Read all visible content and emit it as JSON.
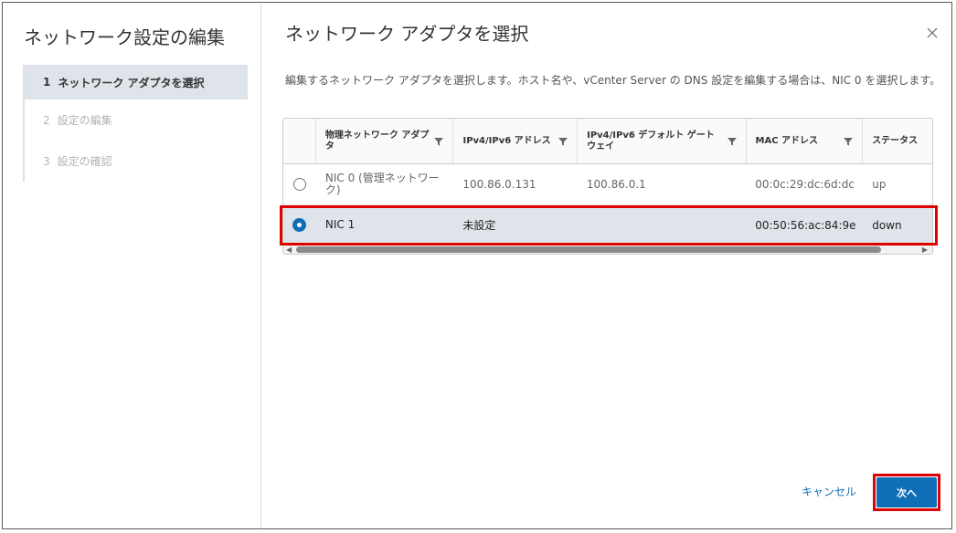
{
  "wizard": {
    "title": "ネットワーク設定の編集",
    "steps": [
      {
        "num": "1",
        "label": "ネットワーク アダプタを選択"
      },
      {
        "num": "2",
        "label": "設定の編集"
      },
      {
        "num": "3",
        "label": "設定の確認"
      }
    ]
  },
  "page": {
    "title": "ネットワーク アダプタを選択",
    "description": "編集するネットワーク アダプタを選択します。ホスト名や、vCenter Server の DNS 設定を編集する場合は、NIC 0 を選択します。",
    "close_icon": "close-icon"
  },
  "grid": {
    "columns": [
      "物理ネットワーク アダプタ",
      "IPv4/IPv6 アドレス",
      "IPv4/IPv6 デフォルト ゲートウェイ",
      "MAC アドレス",
      "ステータス"
    ],
    "rows": [
      {
        "name": "NIC 0 (管理ネットワーク)",
        "ip": "100.86.0.131",
        "gateway": "100.86.0.1",
        "mac": "00:0c:29:dc:6d:dc",
        "status": "up",
        "selected": false
      },
      {
        "name": "NIC 1",
        "ip": "未設定",
        "gateway": "",
        "mac": "00:50:56:ac:84:9e",
        "status": "down",
        "selected": true
      }
    ]
  },
  "footer": {
    "cancel_label": "キャンセル",
    "next_label": "次へ"
  },
  "colors": {
    "accent": "#0f6fb6",
    "selected_row": "#dfe4ea",
    "highlight": "#e00000"
  }
}
